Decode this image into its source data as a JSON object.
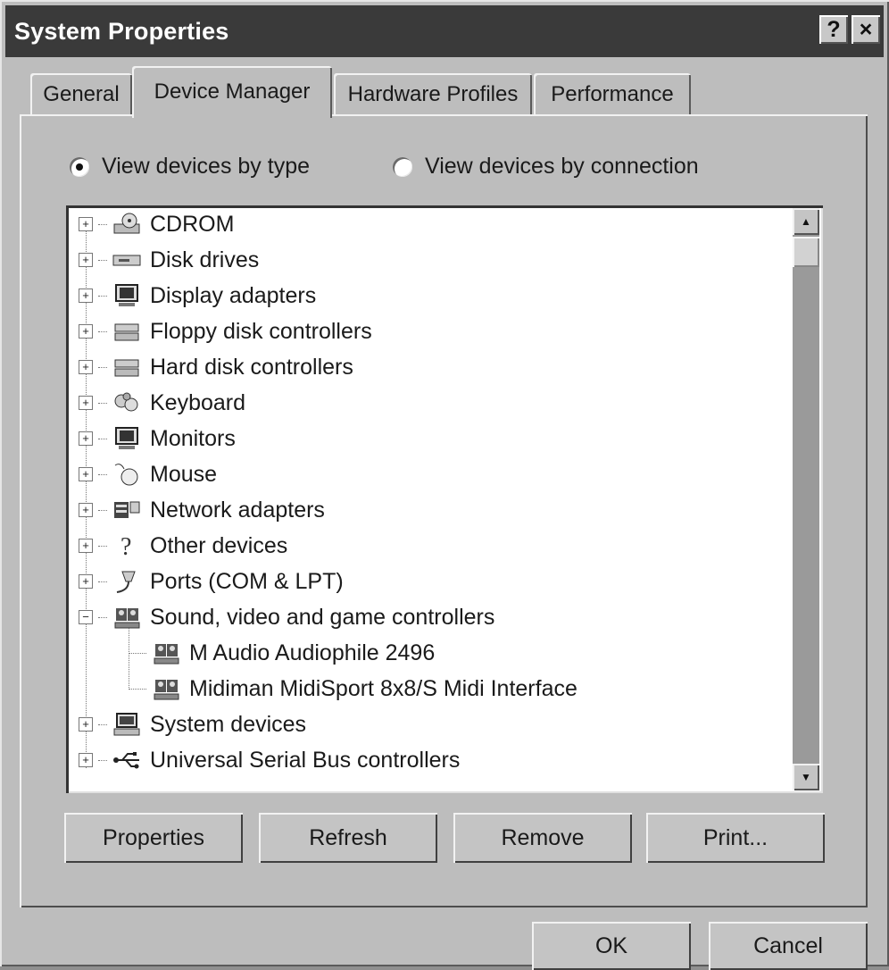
{
  "window": {
    "title": "System Properties"
  },
  "titlebar": {
    "help_label": "?",
    "close_label": "×"
  },
  "tabs": [
    {
      "label": "General"
    },
    {
      "label": "Device Manager"
    },
    {
      "label": "Hardware Profiles"
    },
    {
      "label": "Performance"
    }
  ],
  "active_tab": "Device Manager",
  "view": {
    "by_type": {
      "label": "View devices by type",
      "selected": true
    },
    "by_connection": {
      "label": "View devices by connection",
      "selected": false
    }
  },
  "tree": {
    "items": [
      {
        "label": "CDROM",
        "icon": "cdrom-icon",
        "expander": "+"
      },
      {
        "label": "Disk drives",
        "icon": "disk-drive-icon",
        "expander": "+"
      },
      {
        "label": "Display adapters",
        "icon": "display-adapter-icon",
        "expander": "+"
      },
      {
        "label": "Floppy disk controllers",
        "icon": "floppy-controller-icon",
        "expander": "+"
      },
      {
        "label": "Hard disk controllers",
        "icon": "hard-disk-controller-icon",
        "expander": "+"
      },
      {
        "label": "Keyboard",
        "icon": "keyboard-icon",
        "expander": "+"
      },
      {
        "label": "Monitors",
        "icon": "monitor-icon",
        "expander": "+"
      },
      {
        "label": "Mouse",
        "icon": "mouse-icon",
        "expander": "+"
      },
      {
        "label": "Network adapters",
        "icon": "network-adapter-icon",
        "expander": "+"
      },
      {
        "label": "Other devices",
        "icon": "question-icon",
        "expander": "+"
      },
      {
        "label": "Ports (COM & LPT)",
        "icon": "port-icon",
        "expander": "+"
      },
      {
        "label": "Sound, video and game controllers",
        "icon": "sound-controller-icon",
        "expander": "−"
      },
      {
        "label": "M Audio Audiophile 2496",
        "icon": "sound-device-icon",
        "child": true
      },
      {
        "label": "Midiman MidiSport 8x8/S Midi Interface",
        "icon": "sound-device-icon",
        "child": true
      },
      {
        "label": "System devices",
        "icon": "system-device-icon",
        "expander": "+"
      },
      {
        "label": "Universal Serial Bus controllers",
        "icon": "usb-icon",
        "expander": "+"
      }
    ]
  },
  "buttons": {
    "properties": "Properties",
    "refresh": "Refresh",
    "remove": "Remove",
    "print": "Print...",
    "ok": "OK",
    "cancel": "Cancel"
  }
}
